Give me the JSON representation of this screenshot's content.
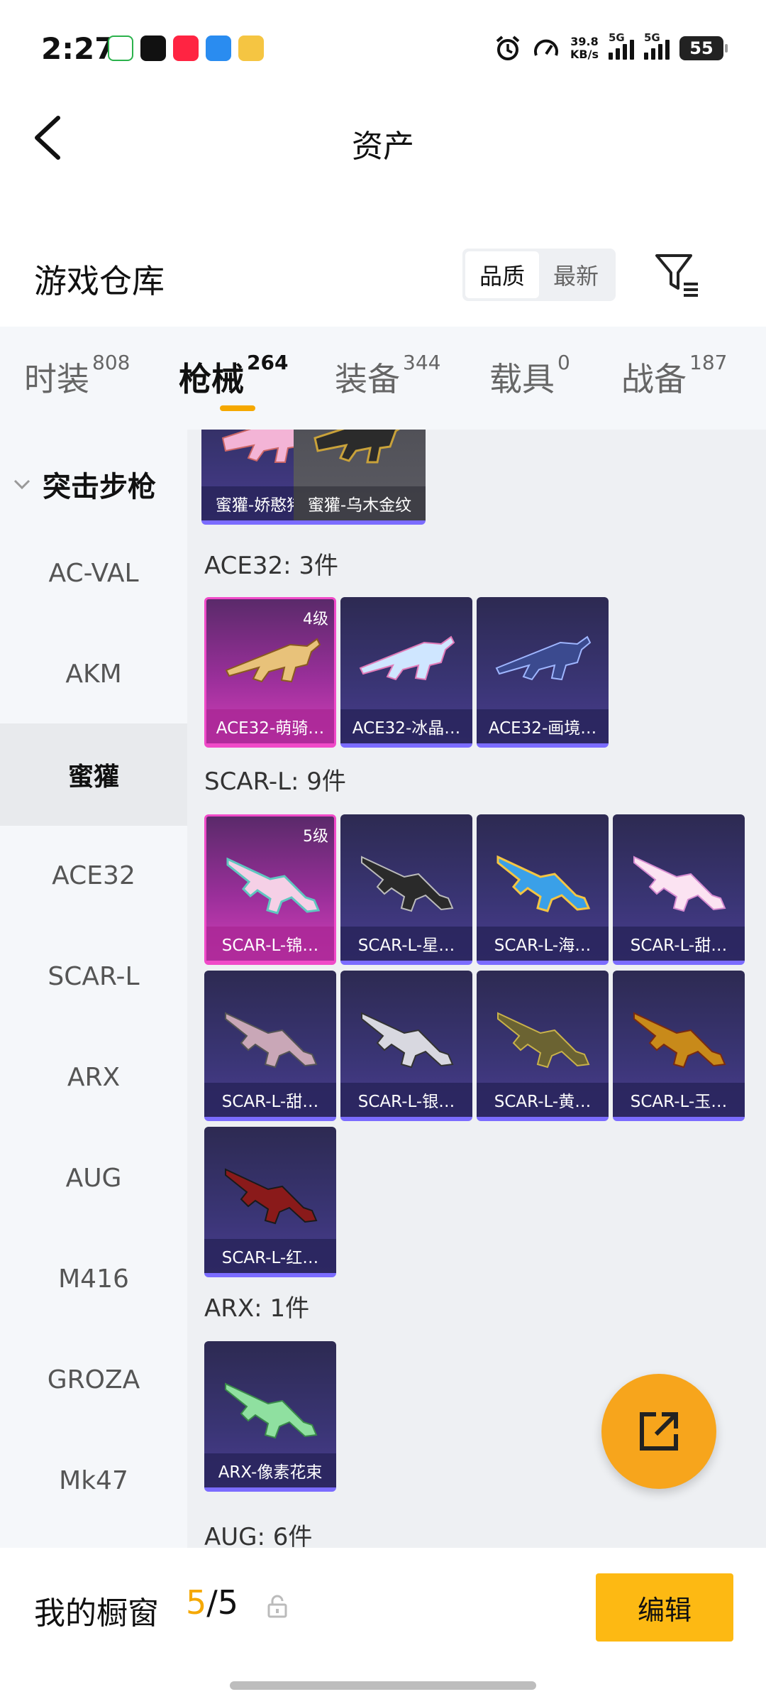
{
  "status_bar": {
    "time": "2:27",
    "net_speed_value": "39.8",
    "net_speed_unit": "KB/s",
    "sim1": "5G",
    "sim2": "5G",
    "battery": "55"
  },
  "header": {
    "title": "资产"
  },
  "section": {
    "title": "游戏仓库",
    "sort_options": [
      "品质",
      "最新"
    ],
    "sort_selected": "品质"
  },
  "tabs": [
    {
      "label": "时装",
      "count": "808"
    },
    {
      "label": "枪械",
      "count": "264"
    },
    {
      "label": "装备",
      "count": "344"
    },
    {
      "label": "载具",
      "count": "0"
    },
    {
      "label": "战备",
      "count": "187"
    }
  ],
  "active_tab": "枪械",
  "sidebar": {
    "category": "突击步枪",
    "items": [
      "AC-VAL",
      "AKM",
      "蜜獾",
      "ACE32",
      "SCAR-L",
      "ARX",
      "AUG",
      "M416",
      "GROZA",
      "Mk47"
    ],
    "active": "蜜獾"
  },
  "content": {
    "top_cards": [
      {
        "name": "蜜獾-娇憨猪猪",
        "style": "purple"
      },
      {
        "name": "蜜獾-乌木金纹",
        "style": "grey"
      }
    ],
    "groups": [
      {
        "title": "ACE32: 3件",
        "cards": [
          {
            "name": "ACE32-萌骑…",
            "level": "4级",
            "style": "pink"
          },
          {
            "name": "ACE32-冰晶…",
            "style": "purple"
          },
          {
            "name": "ACE32-画境…",
            "style": "purple"
          }
        ]
      },
      {
        "title": "SCAR-L: 9件",
        "cards": [
          {
            "name": "SCAR-L-锦…",
            "level": "5级",
            "style": "pink"
          },
          {
            "name": "SCAR-L-星…",
            "style": "purple"
          },
          {
            "name": "SCAR-L-海…",
            "style": "purple"
          },
          {
            "name": "SCAR-L-甜…",
            "style": "purple"
          },
          {
            "name": "SCAR-L-甜…",
            "style": "purple"
          },
          {
            "name": "SCAR-L-银…",
            "style": "purple"
          },
          {
            "name": "SCAR-L-黄…",
            "style": "purple"
          },
          {
            "name": "SCAR-L-玉…",
            "style": "purple"
          },
          {
            "name": "SCAR-L-红…",
            "style": "purple"
          }
        ]
      },
      {
        "title": "ARX: 1件",
        "cards": [
          {
            "name": "ARX-像素花束",
            "style": "purple"
          }
        ]
      },
      {
        "title": "AUG: 6件",
        "cards": []
      }
    ]
  },
  "bottom_bar": {
    "label": "我的橱窗",
    "current": "5",
    "separator": "/",
    "total": "5",
    "edit_label": "编辑"
  },
  "colors": {
    "accent": "#f5a800",
    "edit_button": "#fdb913",
    "fab": "#f7a51c",
    "rare_pink": "#f04ac8",
    "epic_purple": "#7b6cff"
  }
}
